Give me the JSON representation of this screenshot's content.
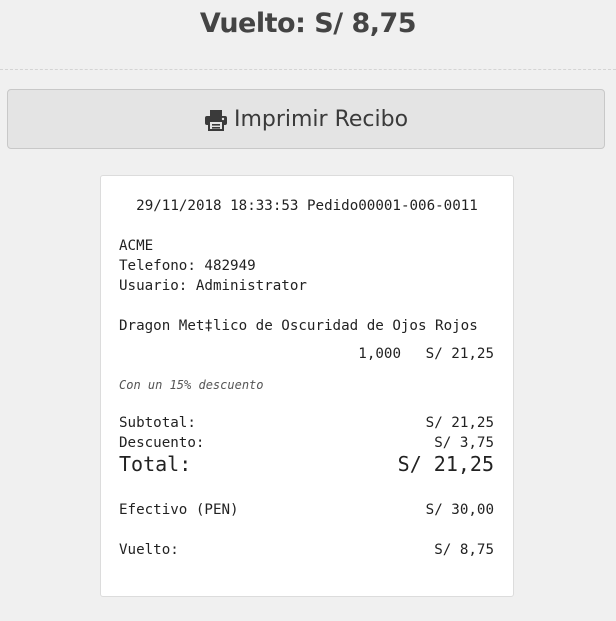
{
  "change_title": "Vuelto: S/ 8,75",
  "print_button": {
    "label": "Imprimir Recibo",
    "icon": "printer-icon"
  },
  "receipt": {
    "header": "29/11/2018 18:33:53 Pedido00001-006-0011",
    "store": {
      "name": "ACME",
      "phone": "Telefono: 482949",
      "user": "Usuario: Administrator"
    },
    "items": [
      {
        "name": "Dragon Met‡lico de Oscuridad de Ojos Rojos",
        "qty": "1,000",
        "price": "S/ 21,25",
        "note": "Con un 15% descuento"
      }
    ],
    "subtotal": {
      "label": "Subtotal:",
      "value": "S/ 21,25"
    },
    "discount": {
      "label": "Descuento:",
      "value": "S/ 3,75"
    },
    "total": {
      "label": "Total:",
      "value": "S/ 21,25"
    },
    "cash": {
      "label": "Efectivo (PEN)",
      "value": "S/ 30,00"
    },
    "change": {
      "label": "Vuelto:",
      "value": "S/ 8,75"
    }
  }
}
